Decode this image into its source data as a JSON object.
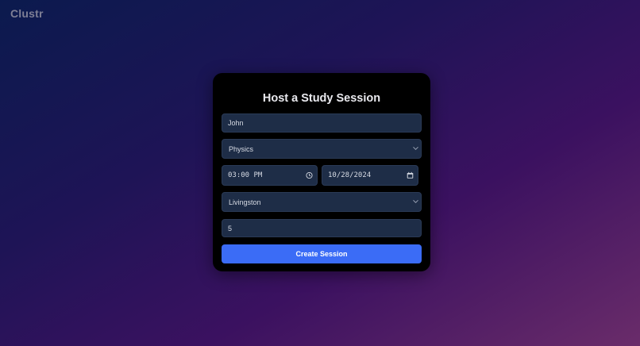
{
  "app": {
    "brand": "Clustr"
  },
  "form": {
    "title": "Host a Study Session",
    "name_value": "John",
    "subject_value": "Physics",
    "time_value": "03:00 PM",
    "date_value": "10/28/2024",
    "location_value": "Livingston",
    "capacity_value": "5",
    "submit_label": "Create Session"
  },
  "icons": {
    "subject_dropdown": "chevron-down-icon",
    "time_picker": "clock-icon",
    "date_picker": "calendar-icon",
    "location_dropdown": "chevron-down-icon"
  },
  "colors": {
    "accent": "#3b6cf6",
    "field_bg": "#1e2d47",
    "card_bg": "#000000"
  }
}
